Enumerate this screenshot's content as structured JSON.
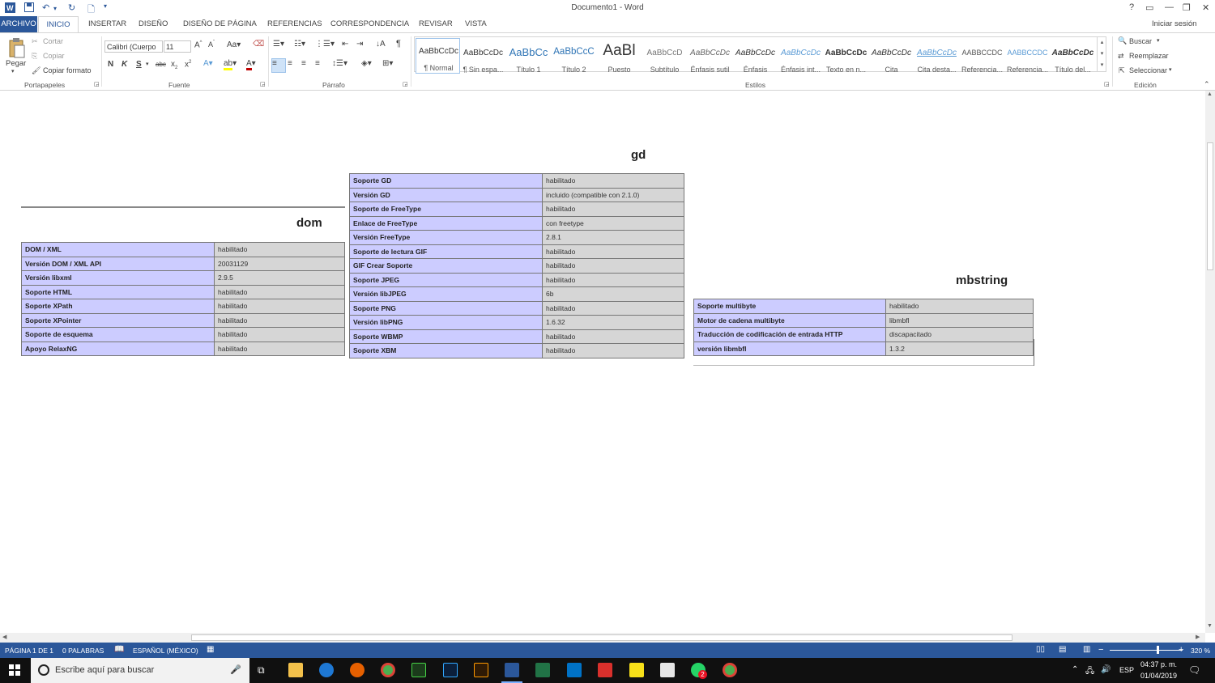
{
  "window": {
    "title": "Documento1 - Word",
    "controls": [
      "?",
      "▭",
      "—",
      "❐",
      "✕"
    ]
  },
  "tabs": {
    "file": "ARCHIVO",
    "items": [
      "INICIO",
      "INSERTAR",
      "DISEÑO",
      "DISEÑO DE PÁGINA",
      "REFERENCIAS",
      "CORRESPONDENCIA",
      "REVISAR",
      "VISTA"
    ],
    "active": "INICIO",
    "signin": "Iniciar sesión"
  },
  "ribbon": {
    "clipboard": {
      "paste": "Pegar",
      "cut": "Cortar",
      "copy": "Copiar",
      "format_painter": "Copiar formato",
      "label": "Portapapeles"
    },
    "font": {
      "name": "Calibri (Cuerpo",
      "size": "11",
      "label": "Fuente"
    },
    "paragraph": {
      "label": "Párrafo"
    },
    "styles": {
      "label": "Estilos",
      "items": [
        {
          "preview": "AaBbCcDc",
          "name": "¶ Normal"
        },
        {
          "preview": "AaBbCcDc",
          "name": "¶ Sin espa..."
        },
        {
          "preview": "AaBbCc",
          "name": "Título 1"
        },
        {
          "preview": "AaBbCcC",
          "name": "Título 2"
        },
        {
          "preview": "AaBl",
          "name": "Puesto"
        },
        {
          "preview": "AaBbCcD",
          "name": "Subtítulo"
        },
        {
          "preview": "AaBbCcDc",
          "name": "Énfasis sutil"
        },
        {
          "preview": "AaBbCcDc",
          "name": "Énfasis"
        },
        {
          "preview": "AaBbCcDc",
          "name": "Énfasis int..."
        },
        {
          "preview": "AaBbCcDc",
          "name": "Texto en n..."
        },
        {
          "preview": "AaBbCcDc",
          "name": "Cita"
        },
        {
          "preview": "AaBbCcDc",
          "name": "Cita desta..."
        },
        {
          "preview": "AABBCCDC",
          "name": "Referencia..."
        },
        {
          "preview": "AABBCCDC",
          "name": "Referencia..."
        },
        {
          "preview": "AaBbCcDc",
          "name": "Título del..."
        }
      ]
    },
    "editing": {
      "label": "Edición",
      "find": "Buscar",
      "replace": "Reemplazar",
      "select": "Seleccionar"
    }
  },
  "document": {
    "dom": {
      "heading": "dom",
      "rows": [
        {
          "k": "DOM / XML",
          "v": "habilitado"
        },
        {
          "k": "Versión DOM / XML API",
          "v": "20031129"
        },
        {
          "k": "Versión libxml",
          "v": "2.9.5"
        },
        {
          "k": "Soporte HTML",
          "v": "habilitado"
        },
        {
          "k": "Soporte XPath",
          "v": "habilitado"
        },
        {
          "k": "Soporte XPointer",
          "v": "habilitado"
        },
        {
          "k": "Soporte de esquema",
          "v": "habilitado"
        },
        {
          "k": "Apoyo RelaxNG",
          "v": "habilitado"
        }
      ]
    },
    "gd": {
      "heading": "gd",
      "rows": [
        {
          "k": "Soporte GD",
          "v": "habilitado"
        },
        {
          "k": "Versión GD",
          "v": "incluido (compatible con 2.1.0)"
        },
        {
          "k": "Soporte de FreeType",
          "v": "habilitado"
        },
        {
          "k": "Enlace de FreeType",
          "v": "con freetype"
        },
        {
          "k": "Versión FreeType",
          "v": "2.8.1"
        },
        {
          "k": "Soporte de lectura GIF",
          "v": "habilitado"
        },
        {
          "k": "GIF Crear Soporte",
          "v": "habilitado"
        },
        {
          "k": "Soporte JPEG",
          "v": "habilitado"
        },
        {
          "k": "Versión libJPEG",
          "v": "6b"
        },
        {
          "k": "Soporte PNG",
          "v": "habilitado"
        },
        {
          "k": "Versión libPNG",
          "v": "1.6.32"
        },
        {
          "k": "Soporte WBMP",
          "v": "habilitado"
        },
        {
          "k": "Soporte XBM",
          "v": "habilitado"
        }
      ]
    },
    "mbstring": {
      "heading": "mbstring",
      "rows": [
        {
          "k": "Soporte multibyte",
          "v": "habilitado"
        },
        {
          "k": "Motor de cadena multibyte",
          "v": "libmbfl"
        },
        {
          "k": "Traducción de codificación de entrada HTTP",
          "v": "discapacitado"
        },
        {
          "k": "versión libmbfl",
          "v": "1.3.2"
        }
      ]
    }
  },
  "statusbar": {
    "page": "PÁGINA 1 DE 1",
    "words": "0 PALABRAS",
    "language": "ESPAÑOL (MÉXICO)",
    "zoom": "320 %"
  },
  "taskbar": {
    "search_placeholder": "Escribe aquí para buscar",
    "lang": "ESP",
    "time": "04:37 p. m.",
    "date": "01/04/2019",
    "whatsapp_badge": "2"
  },
  "colors": {
    "word_blue": "#2b579a",
    "table_key_bg": "#ccccff",
    "table_value_bg": "#d6d6d6"
  }
}
